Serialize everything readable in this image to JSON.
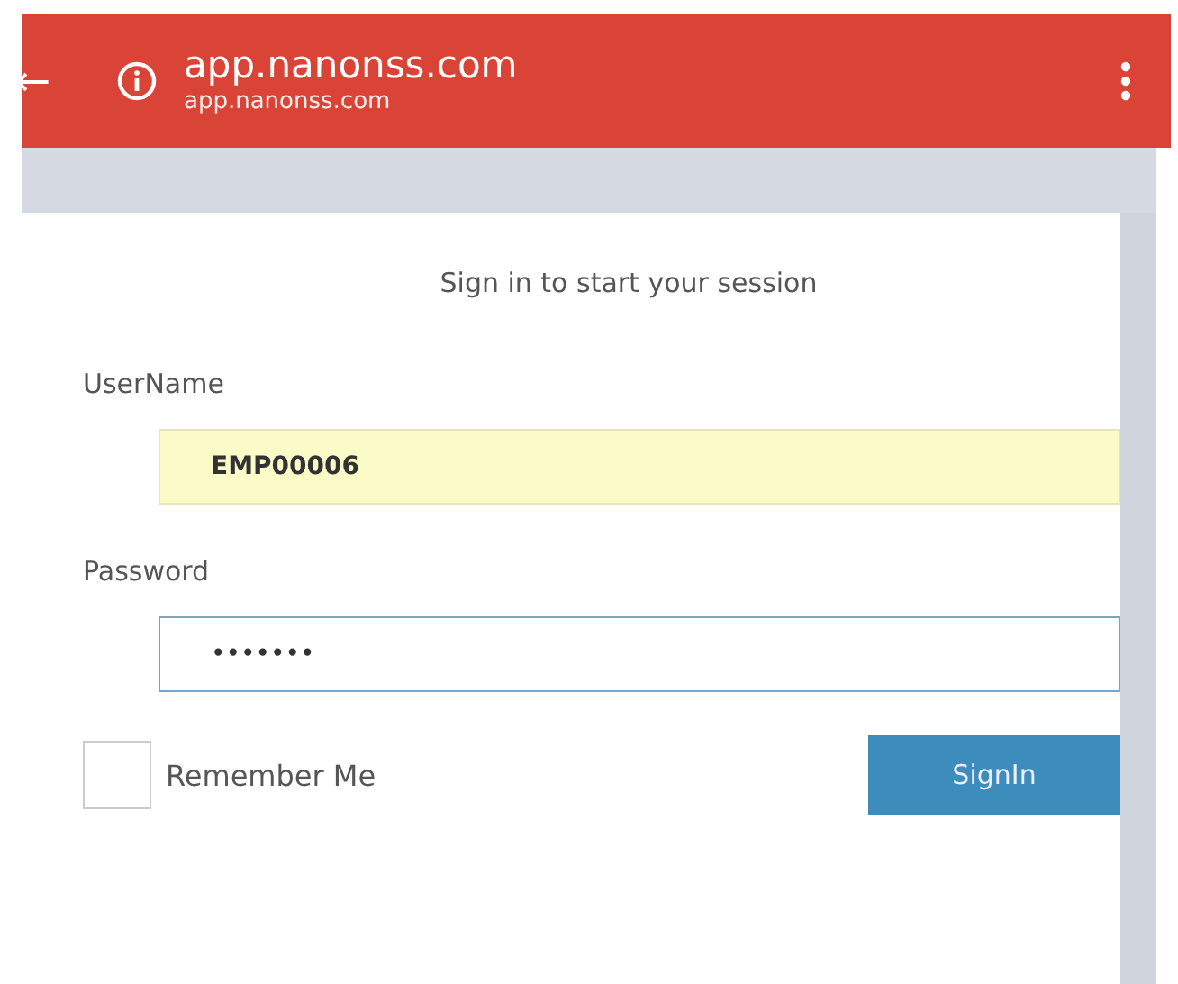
{
  "browser_bar": {
    "back": "←",
    "title": "app.nanonss.com",
    "url": "app.nanonss.com"
  },
  "login": {
    "heading": "Sign in to start your session",
    "fields": [
      {
        "label": "UserName",
        "value": "EMP00006",
        "autofilled": true
      },
      {
        "label": "Password",
        "value": "•••••••",
        "autofilled": false
      }
    ],
    "remember": {
      "label": "Remember Me",
      "checked": false
    },
    "submit": "SignIn"
  }
}
